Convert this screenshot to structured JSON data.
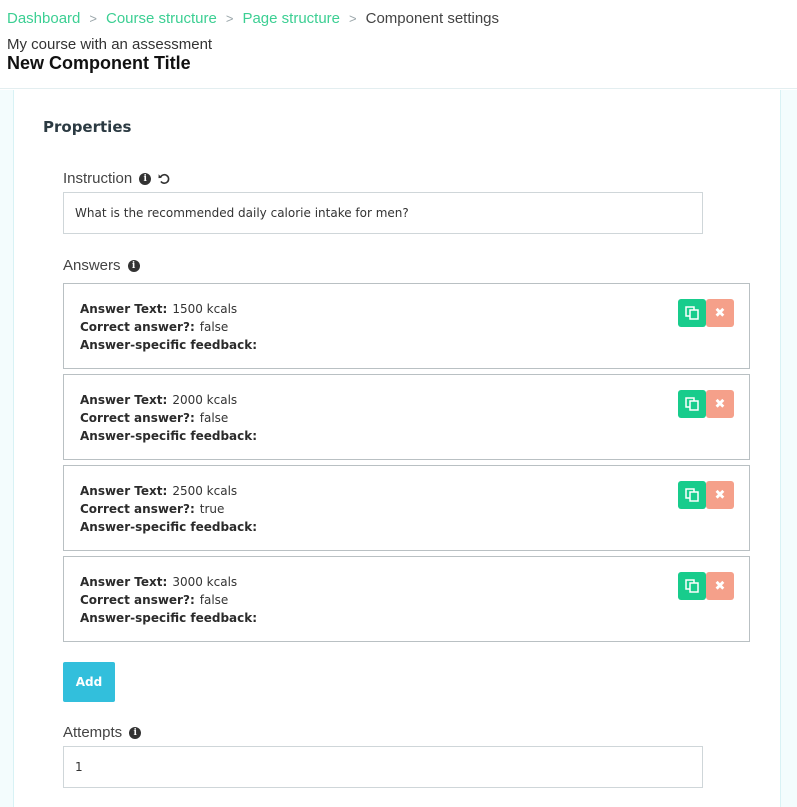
{
  "breadcrumb": {
    "items": [
      "Dashboard",
      "Course structure",
      "Page structure"
    ],
    "separator": ">",
    "current": "Component settings"
  },
  "header": {
    "course_name": "My course with an assessment",
    "title": "New Component Title"
  },
  "properties": {
    "heading": "Properties",
    "instruction": {
      "label": "Instruction",
      "value": "What is the recommended daily calorie intake for men?"
    },
    "answers": {
      "label": "Answers",
      "field_labels": {
        "text": "Answer Text:",
        "correct": "Correct answer?:",
        "feedback": "Answer-specific feedback:"
      },
      "items": [
        {
          "text": "1500 kcals",
          "correct": "false",
          "feedback": ""
        },
        {
          "text": "2000 kcals",
          "correct": "false",
          "feedback": ""
        },
        {
          "text": "2500 kcals",
          "correct": "true",
          "feedback": ""
        },
        {
          "text": "3000 kcals",
          "correct": "false",
          "feedback": ""
        }
      ],
      "add_label": "Add"
    },
    "attempts": {
      "label": "Attempts",
      "value": "1"
    }
  },
  "icons": {
    "info": "info-icon",
    "reset": "undo-icon",
    "copy": "copy-icon",
    "delete": "close-icon"
  },
  "colors": {
    "link": "#3ccf93",
    "copy_button": "#18cc8c",
    "delete_button": "#f5a08a",
    "add_button": "#32bfdc"
  }
}
